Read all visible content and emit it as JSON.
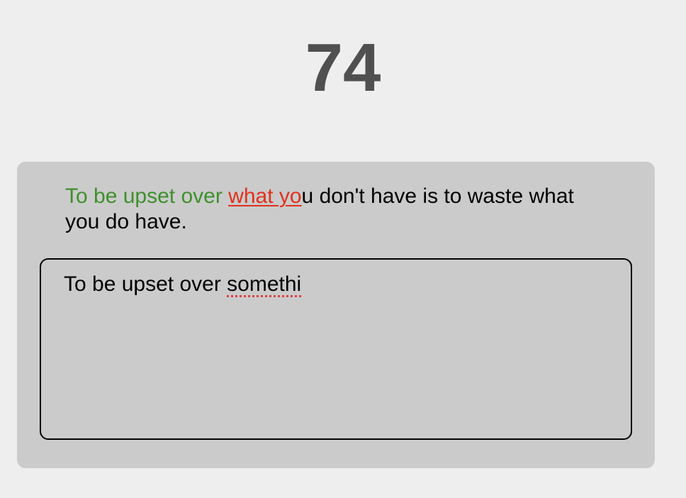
{
  "timer": {
    "value": "74"
  },
  "prompt": {
    "correct_text": "To be upset over ",
    "error_text": "what yo",
    "remaining_text": "u don't have is to waste what you do have.",
    "colors": {
      "correct": "#3f8f2d",
      "error": "#e0301e",
      "remaining": "#000000"
    }
  },
  "typing_area": {
    "typed_text": "To be upset over ",
    "misspelled_word": "somethi"
  }
}
